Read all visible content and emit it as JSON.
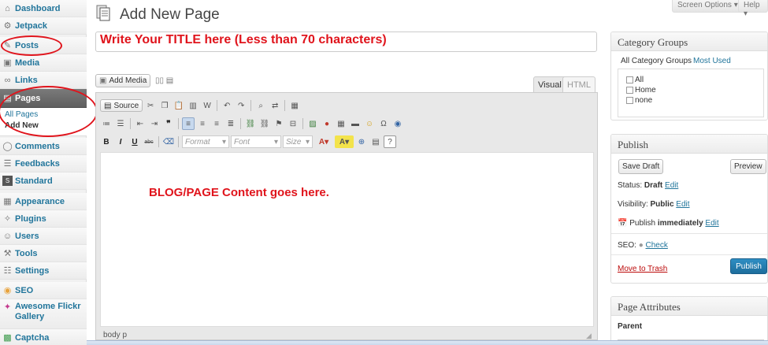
{
  "sidebar": {
    "items": [
      {
        "label": "Dashboard",
        "icon": "home-icon"
      },
      {
        "label": "Jetpack",
        "icon": "jetpack-icon"
      },
      {
        "label": "Posts",
        "icon": "pin-icon"
      },
      {
        "label": "Media",
        "icon": "media-icon"
      },
      {
        "label": "Links",
        "icon": "link-icon"
      },
      {
        "label": "Pages",
        "icon": "pages-icon"
      },
      {
        "label": "Comments",
        "icon": "comment-icon"
      },
      {
        "label": "Feedbacks",
        "icon": "feedback-icon"
      },
      {
        "label": "Standard",
        "icon": "standard-icon"
      },
      {
        "label": "Appearance",
        "icon": "appearance-icon"
      },
      {
        "label": "Plugins",
        "icon": "plugin-icon"
      },
      {
        "label": "Users",
        "icon": "users-icon"
      },
      {
        "label": "Tools",
        "icon": "tools-icon"
      },
      {
        "label": "Settings",
        "icon": "settings-icon"
      },
      {
        "label": "SEO",
        "icon": "seo-icon"
      },
      {
        "label": "Awesome Flickr Gallery",
        "icon": "flickr-icon"
      },
      {
        "label": "Captcha",
        "icon": "captcha-icon"
      }
    ],
    "submenu": {
      "all_pages": "All Pages",
      "add_new": "Add New"
    }
  },
  "header": {
    "title": "Add New Page",
    "screen_options": "Screen Options",
    "help": "Help"
  },
  "title_field": {
    "value": "Write Your TITLE here (Less than 70 characters)"
  },
  "editor": {
    "add_media": "Add Media",
    "tab_visual": "Visual",
    "tab_html": "HTML",
    "source": "Source",
    "format": "Format",
    "font": "Font",
    "size": "Size",
    "content": "BLOG/PAGE Content goes here.",
    "path": "body  p"
  },
  "category_groups": {
    "title": "Category Groups",
    "tab_all": "All Category Groups",
    "tab_most_used": "Most Used",
    "options": [
      "All",
      "Home",
      "none"
    ]
  },
  "publish": {
    "title": "Publish",
    "save_draft": "Save Draft",
    "preview": "Preview",
    "status_label": "Status:",
    "status_value": "Draft",
    "visibility_label": "Visibility:",
    "visibility_value": "Public",
    "publish_label": "Publish",
    "publish_value": "immediately",
    "edit": "Edit",
    "seo_label": "SEO:",
    "seo_check": "Check",
    "move_to_trash": "Move to Trash",
    "publish_button": "Publish"
  },
  "page_attributes": {
    "title": "Page Attributes",
    "parent": "Parent"
  },
  "colors": {
    "annotation": "#e0141c",
    "link": "#21759b",
    "primary_button": "#2e8fc4"
  }
}
